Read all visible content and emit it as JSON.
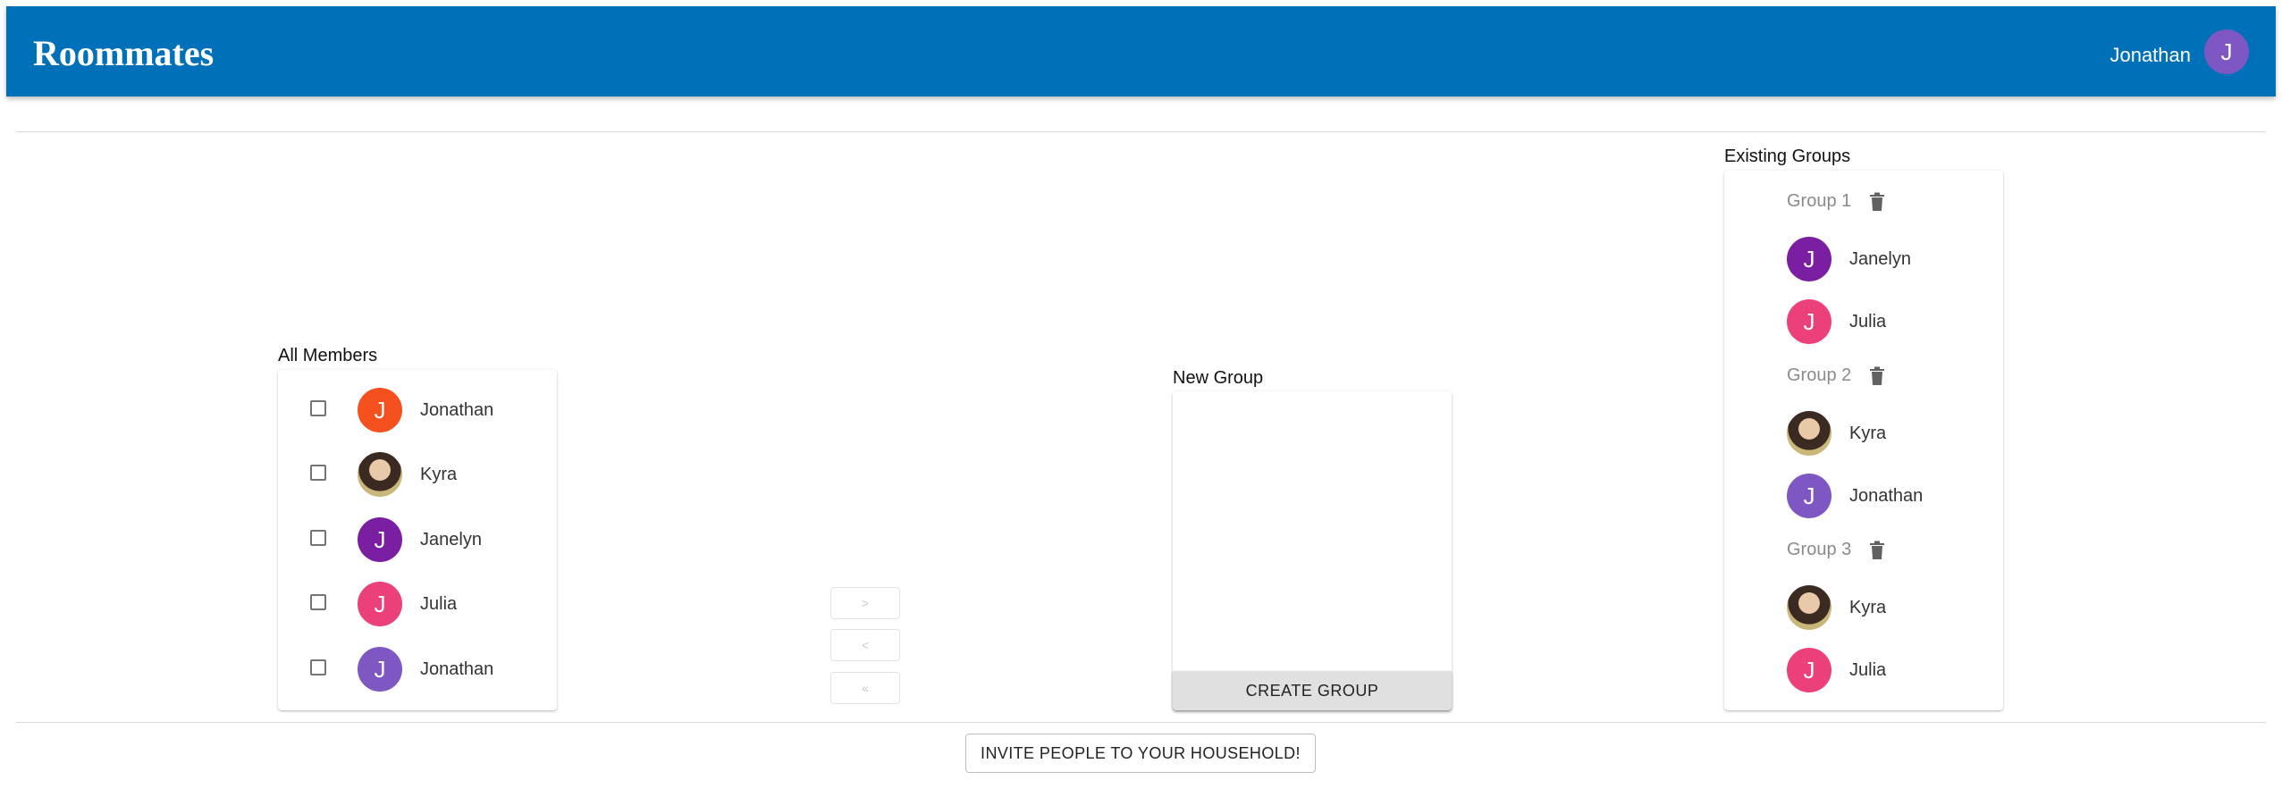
{
  "header": {
    "title": "Roommates",
    "user_name": "Jonathan",
    "user_initial": "J"
  },
  "all_members": {
    "label": "All Members",
    "members": [
      {
        "name": "Jonathan",
        "initial": "J",
        "color": "#f4511e",
        "photo": false
      },
      {
        "name": "Kyra",
        "initial": "",
        "color": "",
        "photo": true
      },
      {
        "name": "Janelyn",
        "initial": "J",
        "color": "#7b1fa2",
        "photo": false
      },
      {
        "name": "Julia",
        "initial": "J",
        "color": "#ec407a",
        "photo": false
      },
      {
        "name": "Jonathan",
        "initial": "J",
        "color": "#7e57c2",
        "photo": false
      }
    ]
  },
  "transfer_buttons": {
    "move_right": ">",
    "move_left": "<",
    "move_all_left": "«"
  },
  "new_group": {
    "label": "New Group",
    "create_button": "CREATE GROUP"
  },
  "existing_groups": {
    "label": "Existing Groups",
    "groups": [
      {
        "name": "Group 1",
        "members": [
          {
            "name": "Janelyn",
            "initial": "J",
            "color": "#7b1fa2",
            "photo": false
          },
          {
            "name": "Julia",
            "initial": "J",
            "color": "#ec407a",
            "photo": false
          }
        ]
      },
      {
        "name": "Group 2",
        "members": [
          {
            "name": "Kyra",
            "initial": "",
            "color": "",
            "photo": true
          },
          {
            "name": "Jonathan",
            "initial": "J",
            "color": "#7e57c2",
            "photo": false
          }
        ]
      },
      {
        "name": "Group 3",
        "members": [
          {
            "name": "Kyra",
            "initial": "",
            "color": "",
            "photo": true
          },
          {
            "name": "Julia",
            "initial": "J",
            "color": "#ec407a",
            "photo": false
          }
        ]
      }
    ]
  },
  "invite_button": "INVITE PEOPLE TO YOUR HOUSEHOLD!",
  "colors": {
    "app_bar": "#0071b8",
    "user_avatar": "#7e57c2"
  }
}
